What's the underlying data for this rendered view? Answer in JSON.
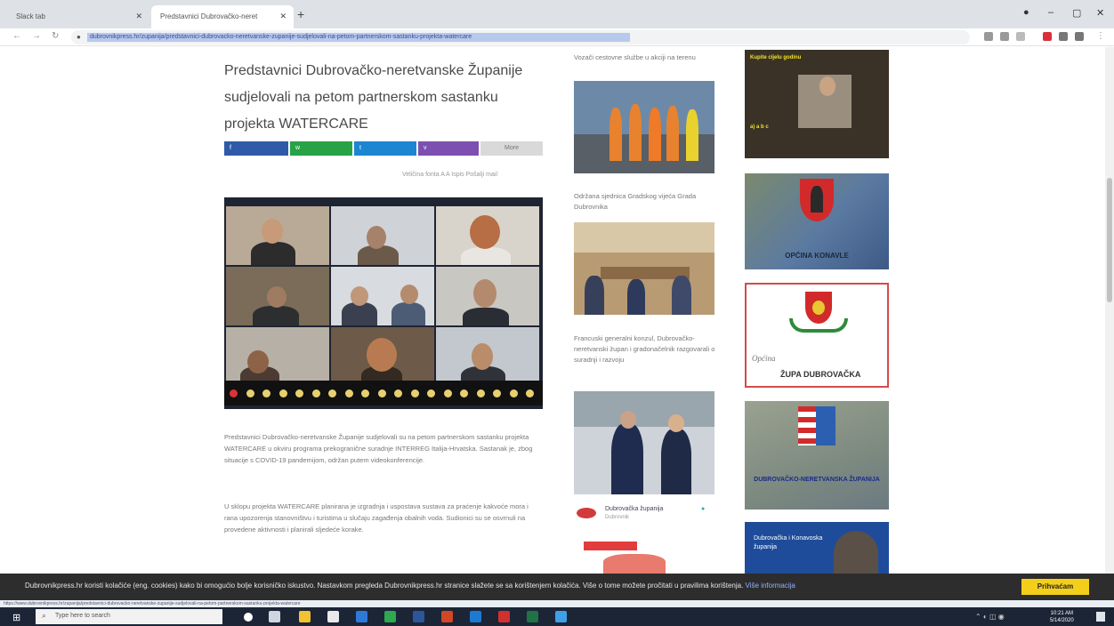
{
  "browser": {
    "tabs": [
      {
        "label": "Slack tab",
        "active": false
      },
      {
        "label": "Predstavnici Dubrovačko-neret",
        "active": true
      }
    ],
    "new_tab": "+",
    "window_controls": [
      "–",
      "▢",
      "✕"
    ],
    "nav": [
      "←",
      "→",
      "↻"
    ],
    "url": "dubrovnikpress.hr/zupanija/predstavnici-dubrovacko-neretvanske-zupanije-sudjelovali-na-petom-partnerskom-sastanku-projekta-watercare"
  },
  "article": {
    "title": "Predstavnici Dubrovačko-neretvanske Županije sudjelovali na petom partnerskom sastanku projekta WATERCARE",
    "share_buttons": [
      {
        "label": "f",
        "color": "#3b5998"
      },
      {
        "label": "w",
        "color": "#25a244"
      },
      {
        "label": "t",
        "color": "#1b8ad3"
      },
      {
        "label": "v",
        "color": "#7d4fb0"
      },
      {
        "label": "More",
        "color": "#d7d7d7"
      }
    ],
    "meta": "Veličina fonta  A  A     Ispis   Pošalji mail",
    "paragraphs": [
      "Predstavnici Dubrovačko-neretvanske Županije sudjelovali su na petom partnerskom sastanku projekta WATERCARE u okviru programa prekogranične suradnje INTERREG Italija-Hrvatska. Sastanak je, zbog situacije s COVID-19 pandemijom, održan putem videokonferencije.",
      "U sklopu projekta WATERCARE planirana je izgradnja i uspostava sustava za praćenje kakvoće mora i rana upozorenja stanovništvu i turistima u slučaju zagađenja obalnih voda. Sudionici su se osvrnuli na provedene aktivnosti i planirali sljedeće korake."
    ]
  },
  "middle_column": {
    "captions": [
      "Vozači cestovne službe u akciji na terenu",
      "Održana sjednica Gradskog vijeća Grada Dubrovnika",
      "Francuski generalni konzul, Dubrovačko-neretvanski župan i gradonačelnik razgovarali o suradnji i razvoju"
    ],
    "social_card": {
      "name": "Dubrovačka županija",
      "sub": "Dubrovnik"
    }
  },
  "ads": [
    {
      "label": "Kupite cijelu godinu",
      "sub": "a)  a  b  c"
    },
    {
      "label": "OPĆINA KONAVLE"
    },
    {
      "label": "Općina",
      "name": "ŽUPA DUBROVAČKA"
    },
    {
      "label": "DUBROVAČKO-NERETVANSKA ŽUPANIJA"
    },
    {
      "label": "Dubrovačka i Konavoska županija"
    }
  ],
  "cookie_bar": {
    "text": "Dubrovnikpress.hr koristi kolačiće (eng. cookies) kako bi omogućio bolje korisničko iskustvo. Nastavkom pregleda Dubrovnikpress.hr stranice slažete se sa korištenjem kolačića. Više o tome možete pročitati u pravilima korištenja.",
    "link": "Više informacija",
    "button": "Prihvaćam"
  },
  "status_url": "https://www.dubrovnikpress.hr/zupanija/predstavnici-dubrovacko-neretvanske-zupanije-sudjelovali-na-petom-partnerskom-sastanku-projekta-watercare",
  "taskbar": {
    "search_placeholder": "Type here to search",
    "time": "10:21 AM",
    "date": "5/14/2020"
  }
}
